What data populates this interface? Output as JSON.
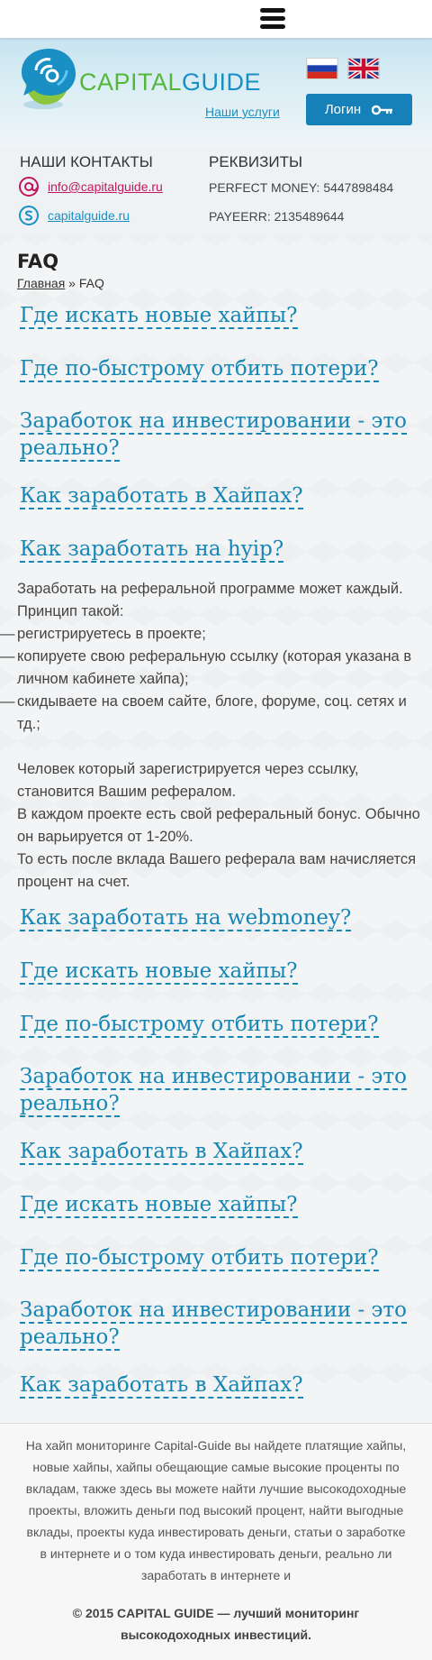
{
  "nav": {
    "menu_icon": "hamburger-menu-icon"
  },
  "header": {
    "logo_part1": "CAPITAL",
    "logo_part2": "GUIDE",
    "services_link": "Наши услуги",
    "login_label": "Логин",
    "login_icon": "key-icon",
    "flags": [
      "ru-flag-icon",
      "en-flag-icon"
    ],
    "colors": {
      "brand_green": "#54b73c",
      "brand_blue": "#1a8fc4",
      "button_blue": "#1681b8"
    }
  },
  "contacts": {
    "title": "НАШИ КОНТАКТЫ",
    "email": "info@capitalguide.ru",
    "skype": "capitalguide.ru",
    "requisites_title": "РЕКВИЗИТЫ",
    "perfect_money": "PERFECT MONEY: 5447898484",
    "payeer": "PAYEERR: 2135489644"
  },
  "page": {
    "title": "FAQ",
    "breadcrumb_home": "Главная",
    "breadcrumb_sep": " » ",
    "breadcrumb_current": "FAQ"
  },
  "faq": {
    "q1": "Где искать новые хайпы?",
    "q2": "Где по-быстрому отбить потери?",
    "q3": "Заработок на инвестировании - это реально?",
    "q4": "Как заработать в Хайпах?",
    "q5": "Как заработать на hyip?",
    "q6": "Как заработать на webmoney?",
    "q7": "Где искать новые хайпы?",
    "q8": "Где по-быстрому отбить потери?",
    "q9": "Заработок на инвестировании - это реально?",
    "q10": "Как заработать в Хайпах?",
    "q11": "Где искать новые хайпы?",
    "q12": "Где по-быстрому отбить потери?",
    "q13": "Заработок на инвестировании - это реально?",
    "q14": "Как заработать в Хайпах?"
  },
  "answer": {
    "intro": "Заработать на реферальной программе может каждый. Принцип такой:",
    "step1": "регистрируетесь в проекте;",
    "step2": "копируете свою реферальную ссылку (которая указана в личном кабинете хайпа);",
    "step3": "скидываете на своем сайте, блоге, форуме, соц. сетях и тд.;",
    "p2": "Человек который зарегистрируется через ссылку, становится Вашим рефералом.",
    "p3": "В каждом проекте есть свой реферальный бонус. Обычно он варьируется от 1-20%.",
    "p4": "То есть после вклада Вашего реферала вам начисляется процент на счет."
  },
  "footer": {
    "text": "На хайп мониторинге Capital-Guide вы найдете платящие хайпы, новые хайпы, хайпы обещающие самые высокие проценты по вкладам, также здесь вы можете найти лучшие высокодоходные проекты, вложить деньги под  высокий процент, найти выгодные вклады, проекты куда инвестировать деньги, статьи о заработке в интернете и о том куда инвестировать деньги, реально ли заработать в интернете и",
    "copyright": "© 2015 CAPITAL GUIDE — лучший мониторинг высокодоходных инвестиций."
  }
}
